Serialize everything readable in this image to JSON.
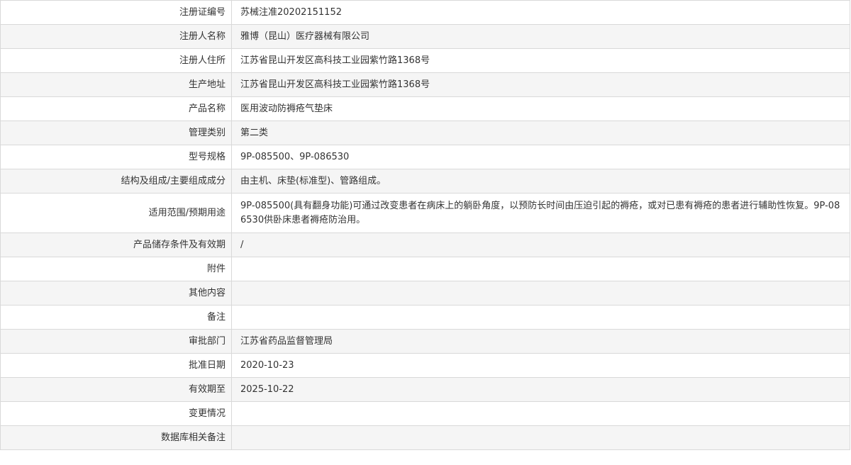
{
  "rows": [
    {
      "label": "注册证编号",
      "value": "苏械注准20202151152"
    },
    {
      "label": "注册人名称",
      "value": "雅博（昆山）医疗器械有限公司"
    },
    {
      "label": "注册人住所",
      "value": "江苏省昆山开发区高科技工业园紫竹路1368号"
    },
    {
      "label": "生产地址",
      "value": "江苏省昆山开发区高科技工业园紫竹路1368号"
    },
    {
      "label": "产品名称",
      "value": "医用波动防褥疮气垫床"
    },
    {
      "label": "管理类别",
      "value": "第二类"
    },
    {
      "label": "型号规格",
      "value": "9P-085500、9P-086530"
    },
    {
      "label": "结构及组成/主要组成成分",
      "value": "由主机、床垫(标准型)、管路组成。"
    },
    {
      "label": "适用范围/预期用途",
      "value": "9P-085500(具有翻身功能)可通过改变患者在病床上的躺卧角度，以预防长时间由压迫引起的褥疮，或对已患有褥疮的患者进行辅助性恢复。9P-086530供卧床患者褥疮防治用。"
    },
    {
      "label": "产品储存条件及有效期",
      "value": "/"
    },
    {
      "label": "附件",
      "value": ""
    },
    {
      "label": "其他内容",
      "value": ""
    },
    {
      "label": "备注",
      "value": ""
    },
    {
      "label": "审批部门",
      "value": "江苏省药品监督管理局"
    },
    {
      "label": "批准日期",
      "value": "2020-10-23"
    },
    {
      "label": "有效期至",
      "value": "2025-10-22"
    },
    {
      "label": "变更情况",
      "value": ""
    },
    {
      "label": "数据库相关备注",
      "value": ""
    }
  ]
}
